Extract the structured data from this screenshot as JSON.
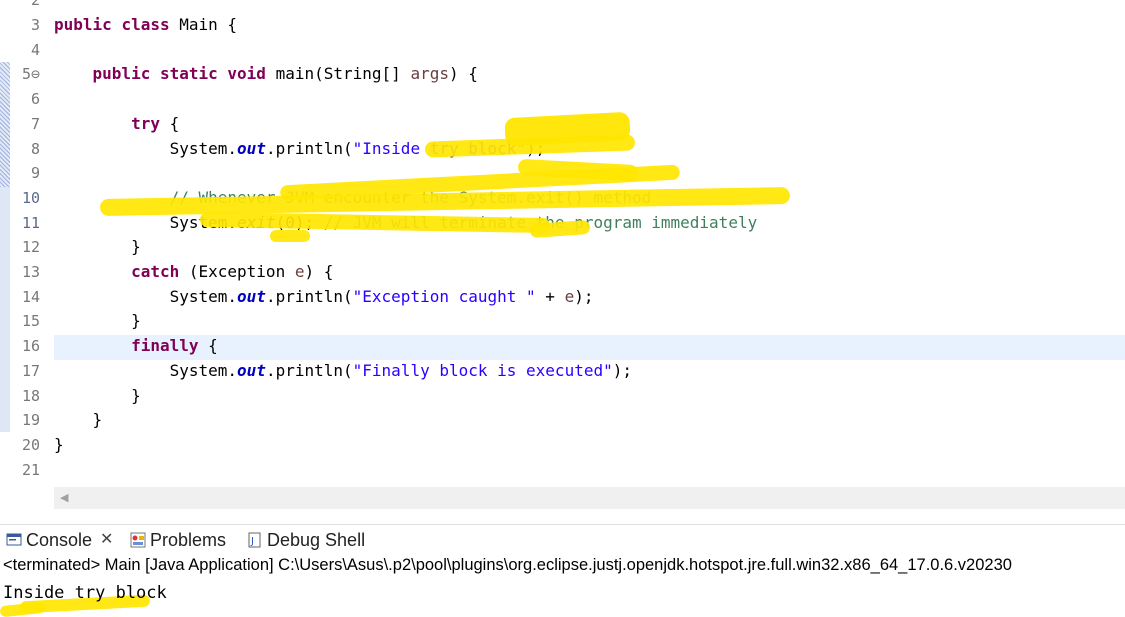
{
  "editor": {
    "lines": [
      {
        "n": "3",
        "html": "<span class=\"kw\">public</span> <span class=\"kw\">class</span> Main {"
      },
      {
        "n": "4",
        "html": ""
      },
      {
        "n": "5⊖",
        "html": "    <span class=\"kw\">public</span> <span class=\"kw\">static</span> <span class=\"kw\">void</span> main(String[] <span class=\"prm\">args</span>) {"
      },
      {
        "n": "6",
        "html": ""
      },
      {
        "n": "7",
        "html": "        <span class=\"kw\">try</span> {"
      },
      {
        "n": "8",
        "html": "            System.<span class=\"fld\">out</span>.println(<span class=\"str\">\"Inside try block\"</span>);"
      },
      {
        "n": "9",
        "html": ""
      },
      {
        "n": "10",
        "html": "            <span class=\"cm\">// Whenever JVM encounter the System.exit() method</span>"
      },
      {
        "n": "11",
        "html": "            System.<span class=\"sm\">exit</span>(0); <span class=\"cm\">// JVM will terminate the program immediately</span>"
      },
      {
        "n": "12",
        "html": "        }"
      },
      {
        "n": "13",
        "html": "        <span class=\"kw\">catch</span> (Exception <span class=\"prm\">e</span>) {"
      },
      {
        "n": "14",
        "html": "            System.<span class=\"fld\">out</span>.println(<span class=\"str\">\"Exception caught \"</span> + <span class=\"prm\">e</span>);"
      },
      {
        "n": "15",
        "html": "        }"
      },
      {
        "n": "16",
        "html": "        <span class=\"kw\">finally</span> {"
      },
      {
        "n": "17",
        "html": "            System.<span class=\"fld\">out</span>.println(<span class=\"str\">\"Finally block is executed\"</span>);"
      },
      {
        "n": "18",
        "html": "        }"
      },
      {
        "n": "19",
        "html": "    }"
      },
      {
        "n": "20",
        "html": "}"
      },
      {
        "n": "21",
        "html": ""
      }
    ]
  },
  "console": {
    "tabs": [
      {
        "label": "Console",
        "icon": "console-icon",
        "closable": true
      },
      {
        "label": "Problems",
        "icon": "problems-icon",
        "closable": false
      },
      {
        "label": "Debug Shell",
        "icon": "debug-shell-icon",
        "closable": false
      }
    ],
    "status": "<terminated> Main [Java Application] C:\\Users\\Asus\\.p2\\pool\\plugins\\org.eclipse.justj.openjdk.hotspot.jre.full.win32.x86_64_17.0.6.v20230",
    "output": "Inside try block"
  },
  "colors": {
    "keyword": "#7f0055",
    "string": "#2a00ff",
    "comment": "#3f7f5f",
    "field": "#0000c0",
    "highlight": "#ffe600",
    "current_line": "#e8f2fe"
  }
}
